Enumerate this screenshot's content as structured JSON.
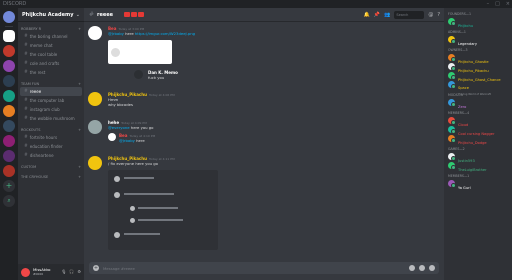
{
  "titlebar": {
    "title": "DISCORD"
  },
  "server": {
    "name": "Phijkchu Academy"
  },
  "channel_categories": [
    {
      "label": "ROBBERY R",
      "channels": [
        "the boring channel",
        "meme chat",
        "the cool table",
        "cole and crafts",
        "the rest"
      ]
    },
    {
      "label": "TEAM FUN",
      "channels": [
        "reeee",
        "the computer lab",
        "instagram club",
        "the wobble mushroom"
      ]
    },
    {
      "label": "ROCKOUTS",
      "channels": [
        "fortnite hours",
        "education finder",
        "disheartene"
      ]
    },
    {
      "label": "CUSTOM",
      "channels": []
    },
    {
      "label": "THE CRYHOUSE",
      "channels": []
    }
  ],
  "user_panel": {
    "name": "MissAkko",
    "tag": "#0000"
  },
  "header": {
    "channel": "reeee",
    "search_placeholder": "Search"
  },
  "messages": [
    {
      "author": "Bea",
      "time": "Today at 3:00 PM",
      "text": "here",
      "mention": "@Jrbaby",
      "link": "https://imgur.com/W23deeJ.png"
    },
    {
      "author": "Dan K. Memo",
      "time": "",
      "text": "fuck you"
    },
    {
      "author": "Phijkchu_Pikachu",
      "time": "Today at 4:06 PM",
      "text": "Hmm",
      "text2": "why bbcodes"
    },
    {
      "author": "hehe",
      "time": "Today at 4:09 PM",
      "mention": "@everyone",
      "text": "here you go"
    },
    {
      "author": "Bea",
      "time": "Today at 4:10 PM",
      "mention": "@Jrbaby",
      "text": "here"
    },
    {
      "author": "Phijkchu_Pikachu",
      "time": "Today at 4:11 PM",
      "text": "/ fix everyone here you go"
    }
  ],
  "composer": {
    "placeholder": "Message #reeee"
  },
  "members": {
    "groups": [
      {
        "label": "FOUNDERS—1",
        "names": [
          "Phijkchu"
        ]
      },
      {
        "label": "ADMINS—1",
        "names": [
          "Legendary"
        ]
      },
      {
        "label": "OWNERS—3",
        "names": [
          "Phijkchu_Ghostie",
          "Phijkchu_Pikachu",
          "Phijkchu_Ghost_Chance",
          "Space"
        ]
      },
      {
        "label": "MODS—1",
        "names": [
          "Zero"
        ]
      },
      {
        "label": "MEMBERS—4",
        "names": [
          "Cloud",
          "Cool cursing Nagger",
          "Phijkchu_Dodge"
        ]
      },
      {
        "label": "GAMES—2",
        "names": [
          "Justin593",
          "TheLuigiBrother"
        ]
      },
      {
        "label": "MEMBERS—1",
        "names": [
          "Ya Gurl"
        ]
      }
    ],
    "statuses": {
      "Phijkchu_Ghost_Chance": "",
      "Space": "Playing World of Warcraft"
    }
  },
  "colors": {
    "accent": "#7289da",
    "online": "#43b581",
    "red": "#f04747"
  },
  "guild_icons": [
    "home-icon",
    "server-icon",
    "server-icon",
    "server-icon",
    "server-icon",
    "server-icon",
    "server-icon",
    "server-icon",
    "server-icon",
    "server-icon",
    "server-icon",
    "add-server-icon",
    "explore-icon"
  ]
}
